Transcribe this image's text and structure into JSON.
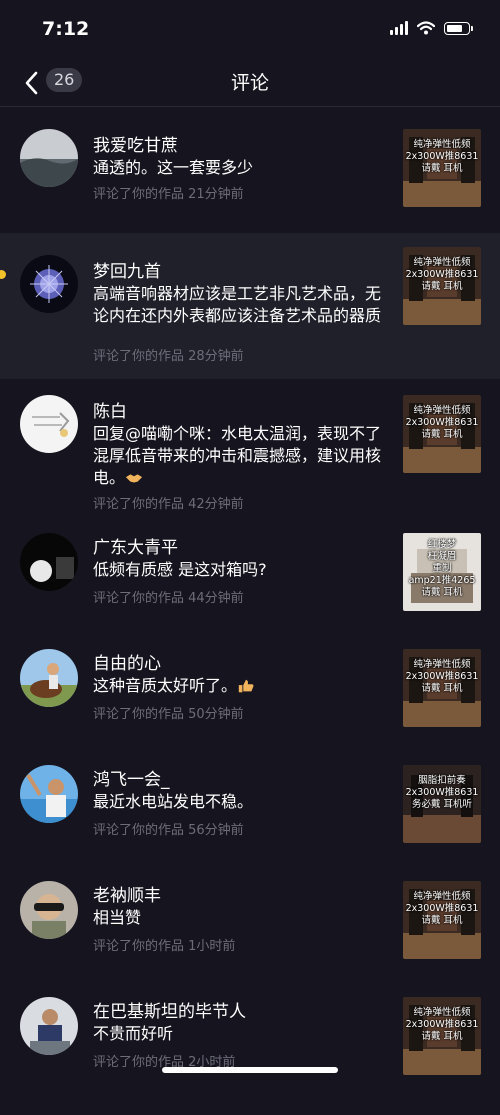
{
  "status_bar": {
    "time": "7:12"
  },
  "nav": {
    "title": "评论",
    "count": "26"
  },
  "comments": [
    {
      "name": "我爱吃甘蔗",
      "text": "通透的。这一套要多少",
      "meta": "评论了你的作品  21分钟前",
      "thumb_text": "纯净弹性低频\n2x300W推8631\n请戴  耳机"
    },
    {
      "name": "梦回九首",
      "text": "高端音响器材应该是工艺非凡艺术品，无论内在还内外表都应该注备艺术品的器质",
      "meta": "评论了你的作品  28分钟前",
      "thumb_text": "纯净弹性低频\n2x300W推8631\n请戴  耳机"
    },
    {
      "name": "陈白",
      "text": "回复@喵嘞个咪：水电太温润，表现不了混厚低音带来的冲击和震撼感，建议用核电。",
      "meta": "评论了你的作品  42分钟前",
      "thumb_text": "纯净弹性低频\n2x300W推8631\n请戴  耳机"
    },
    {
      "name": "广东大青平",
      "text": "低频有质感 是这对箱吗?",
      "meta": "评论了你的作品  44分钟前",
      "thumb_text": "红楼梦\n枉凝眉\n重制\namp21推4265\n请戴  耳机"
    },
    {
      "name": "自由的心",
      "text": "这种音质太好听了。",
      "meta": "评论了你的作品  50分钟前",
      "thumb_text": "纯净弹性低频\n2x300W推8631\n请戴  耳机"
    },
    {
      "name": "鸿飞一会_",
      "text": "最近水电站发电不稳。",
      "meta": "评论了你的作品  56分钟前",
      "thumb_text": "胭脂扣前奏\n2x300W推8631\n务必戴  耳机听"
    },
    {
      "name": "老衲顺丰",
      "text": "相当赞",
      "meta": "评论了你的作品  1小时前",
      "thumb_text": "纯净弹性低频\n2x300W推8631\n请戴  耳机"
    },
    {
      "name": "在巴基斯坦的毕节人",
      "text": "不贵而好听",
      "meta": "评论了你的作品  2小时前",
      "thumb_text": "纯净弹性低频\n2x300W推8631\n请戴  耳机"
    }
  ],
  "icons": {
    "back": "chevron-left-icon",
    "signal": "cellular-signal-icon",
    "wifi": "wifi-icon",
    "battery": "battery-icon",
    "handshake": "handshake-emoji",
    "thumbs_up": "thumbs-up-emoji"
  },
  "colors": {
    "background": "#16151f",
    "highlight_row": "#20202b",
    "meta_text": "#6d6c78",
    "unread_dot": "#f4c22b"
  }
}
